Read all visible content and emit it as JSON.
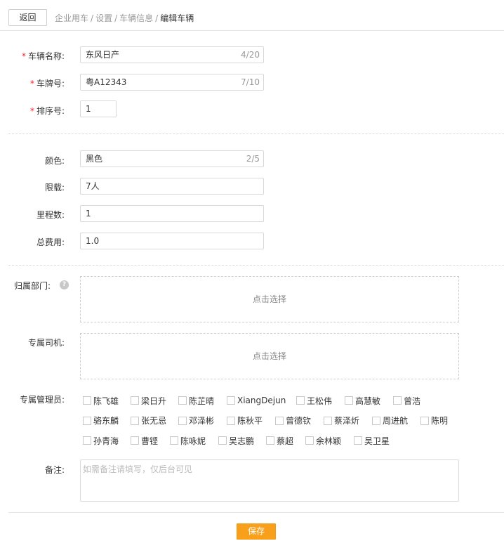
{
  "header": {
    "back_label": "返回",
    "breadcrumb": [
      "企业用车",
      "设置",
      "车辆信息",
      "编辑车辆"
    ],
    "separator": "/"
  },
  "form": {
    "required_mark": "*",
    "vehicle_name": {
      "label": "车辆名称:",
      "value": "东风日产",
      "counter": "4/20"
    },
    "plate_no": {
      "label": "车牌号:",
      "value": "粤A12343",
      "counter": "7/10"
    },
    "sort_no": {
      "label": "排序号:",
      "value": "1"
    },
    "color": {
      "label": "颜色:",
      "value": "黑色",
      "counter": "2/5"
    },
    "capacity": {
      "label": "限载:",
      "value": "7人"
    },
    "mileage": {
      "label": "里程数:",
      "value": "1"
    },
    "total_cost": {
      "label": "总费用:",
      "value": "1.0"
    },
    "department": {
      "label": "归属部门:",
      "help": "?",
      "placeholder": "点击选择"
    },
    "driver": {
      "label": "专属司机:",
      "placeholder": "点击选择"
    },
    "admins": {
      "label": "专属管理员:",
      "rows": [
        [
          "陈飞雄",
          "梁日升",
          "陈芷晴",
          "XiangDejun",
          "王松伟",
          "高慧敏",
          "曾浩"
        ],
        [
          "骆东麟",
          "张无忌",
          "邓泽彬",
          "陈秋平",
          "曾德钦",
          "蔡泽炘",
          "周进航",
          "陈明"
        ],
        [
          "孙青海",
          "曹铿",
          "陈咏妮",
          "吴志鹏",
          "蔡超",
          "余林颖",
          "吴卫星"
        ]
      ]
    },
    "remark": {
      "label": "备注:",
      "placeholder": "如需备注请填写，仅后台可见"
    }
  },
  "footer": {
    "save_label": "保存"
  },
  "colors": {
    "accent": "#f8a01c",
    "required": "#f5222d",
    "border": "#d9d9d9"
  }
}
